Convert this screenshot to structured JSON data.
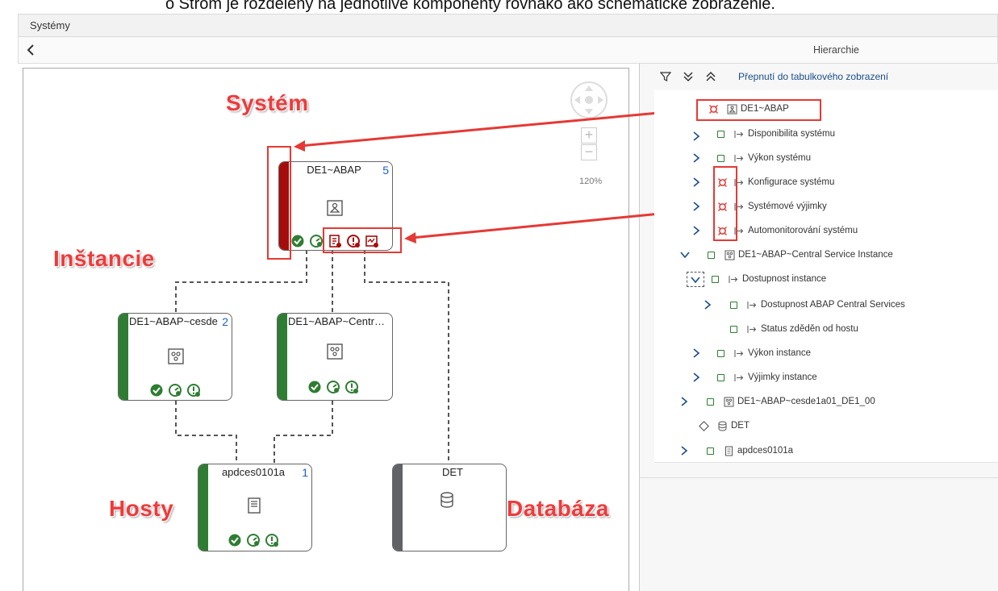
{
  "doc_text": "o     Strom je rozdelený na jednotlivé komponenty rovnako ako schematické zobrazenie.",
  "window": {
    "title": "Systémy"
  },
  "subbar": {
    "back_glyph": "‹",
    "hierarchy_title": "Hierarchie"
  },
  "zoom": {
    "plus": "+",
    "minus": "−",
    "level": "120%"
  },
  "nodes": {
    "system": {
      "title": "DE1~ABAP",
      "count": "5",
      "status_color": "#a50d0d",
      "icon": "system-icon"
    },
    "instance_cesde": {
      "title": "DE1~ABAP~cesde",
      "count": "2",
      "status_color": "#2e7d32",
      "icon": "instance-icon"
    },
    "instance_central": {
      "title": "DE1~ABAP~Central ...",
      "count": "",
      "status_color": "#2e7d32",
      "icon": "instance-icon"
    },
    "host": {
      "title": "apdces0101a",
      "count": "1",
      "status_color": "#2e7d32",
      "icon": "host-icon"
    },
    "database": {
      "title": "DET",
      "count": "",
      "status_color": "#5f6368",
      "icon": "database-icon"
    }
  },
  "labels": {
    "system": "Systém",
    "instances": "Inštancie",
    "hosts": "Hosty",
    "database": "Databáza"
  },
  "hierarchy_toolbar": {
    "toggle_link": "Přepnutí do tabulkového zobrazení"
  },
  "tree": [
    {
      "label": "DE1~ABAP",
      "status": "critical",
      "icon": "system-icon",
      "expandable": false
    },
    {
      "label": "Disponibilita systému",
      "status": "ok",
      "icon": "metric-icon",
      "expandable": true
    },
    {
      "label": "Výkon systému",
      "status": "ok",
      "icon": "metric-icon",
      "expandable": true
    },
    {
      "label": "Konfigurace systému",
      "status": "critical",
      "icon": "metric-icon",
      "expandable": true
    },
    {
      "label": "Systémové výjimky",
      "status": "critical",
      "icon": "metric-icon",
      "expandable": true
    },
    {
      "label": "Automonitorování systému",
      "status": "critical",
      "icon": "metric-icon",
      "expandable": true
    },
    {
      "label": "DE1~ABAP~Central Service Instance",
      "status": "ok",
      "icon": "instance-icon",
      "expandable": true,
      "expanded": true
    },
    {
      "label": "Dostupnost instance",
      "status": "ok",
      "icon": "metric-icon",
      "expandable": true,
      "expanded": true,
      "focused": true
    },
    {
      "label": "Dostupnost ABAP Central Services",
      "status": "ok",
      "icon": "metric-icon",
      "expandable": true
    },
    {
      "label": "Status zděděn od hostu",
      "status": "ok",
      "icon": "metric-icon",
      "expandable": false
    },
    {
      "label": "Výkon instance",
      "status": "ok",
      "icon": "metric-icon",
      "expandable": true
    },
    {
      "label": "Výjimky instance",
      "status": "ok",
      "icon": "metric-icon",
      "expandable": true
    },
    {
      "label": "DE1~ABAP~cesde1a01_DE1_00",
      "status": "ok",
      "icon": "instance-icon",
      "expandable": true
    },
    {
      "label": "DET",
      "status": "unknown",
      "icon": "database-icon",
      "expandable": false
    },
    {
      "label": "apdces0101a",
      "status": "ok",
      "icon": "host-icon",
      "expandable": true
    }
  ],
  "colors": {
    "critical": "#e53935",
    "ok": "#2e7d32",
    "annotation": "#e53935",
    "link": "#1a4d8a"
  }
}
